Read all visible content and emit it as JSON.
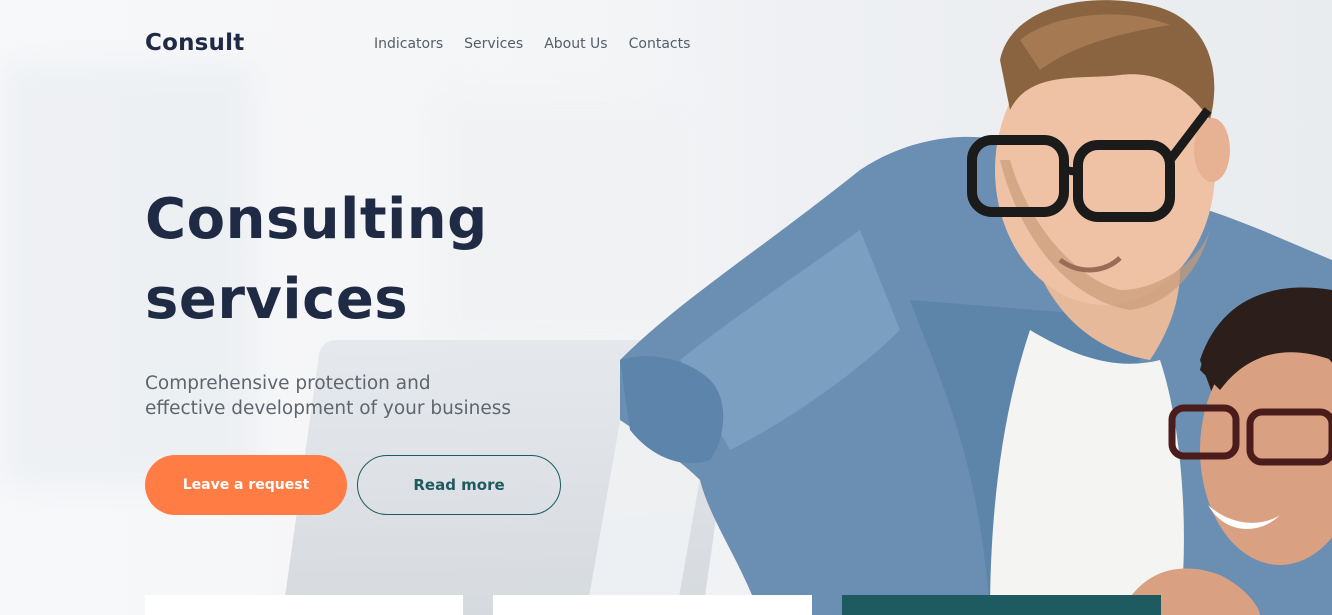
{
  "brand": {
    "logo": "Consult"
  },
  "nav": {
    "items": [
      {
        "label": "Indicators"
      },
      {
        "label": "Services"
      },
      {
        "label": "About Us"
      },
      {
        "label": "Contacts"
      }
    ]
  },
  "hero": {
    "title_line1": "Consulting",
    "title_line2": "services",
    "subtitle_line1": "Comprehensive protection and",
    "subtitle_line2": "effective development of your business",
    "primary_button": "Leave a request",
    "secondary_button": "Read more"
  },
  "colors": {
    "primary": "#ff7d45",
    "dark": "#1f2a44",
    "teal": "#1d5b61"
  }
}
